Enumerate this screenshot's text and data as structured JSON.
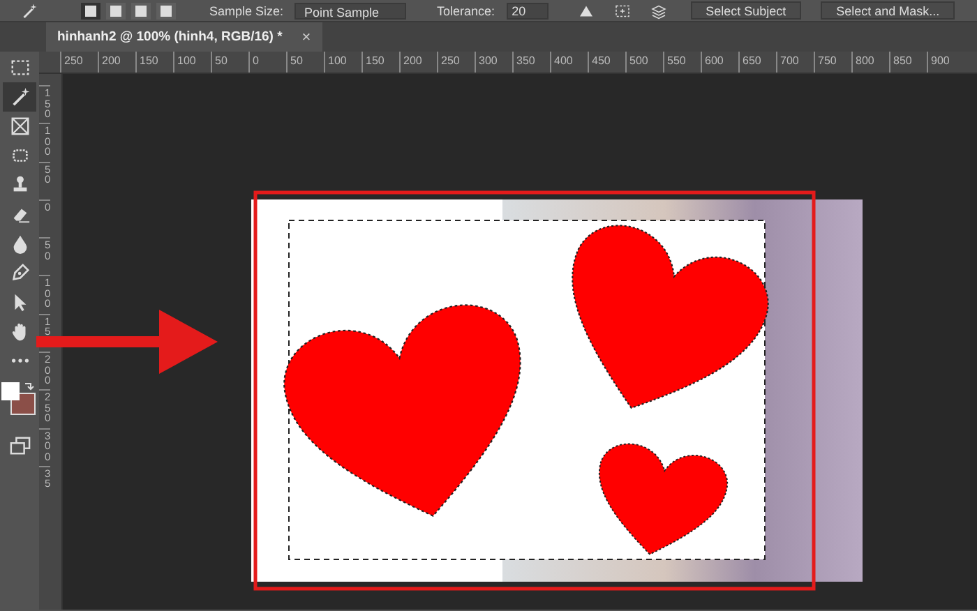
{
  "options_bar": {
    "selection_modes": [
      {
        "selected": true
      },
      {
        "selected": false
      },
      {
        "selected": false
      },
      {
        "selected": false
      }
    ],
    "sample_size_label": "Sample Size:",
    "sample_size_value": "Point Sample",
    "tolerance_label": "Tolerance:",
    "tolerance_value": "20",
    "buttons": [
      "Select Subject",
      "Select and Mask..."
    ]
  },
  "document_tab": {
    "title": "hinhanh2 @ 100% (hinh4, RGB/16) *",
    "close": "×"
  },
  "horizontal_ruler": [
    "250",
    "200",
    "150",
    "100",
    "50",
    "0",
    "50",
    "100",
    "150",
    "200",
    "250",
    "300",
    "350",
    "400",
    "450",
    "500",
    "550",
    "600",
    "650",
    "700",
    "750",
    "800",
    "850",
    "900"
  ],
  "vertical_ruler": [
    "150",
    "100",
    "50",
    "0",
    "50",
    "100",
    "15",
    "200",
    "250",
    "300",
    "35"
  ],
  "tools": [
    {
      "kind": "marquee",
      "selected": false
    },
    {
      "kind": "wand",
      "selected": true
    },
    {
      "kind": "frame",
      "selected": false
    },
    {
      "kind": "patch",
      "selected": false
    },
    {
      "kind": "stamp",
      "selected": false
    },
    {
      "kind": "eraser",
      "selected": false
    },
    {
      "kind": "drop",
      "selected": false
    },
    {
      "kind": "pen",
      "selected": false
    },
    {
      "kind": "pointer",
      "selected": false
    },
    {
      "kind": "hand",
      "selected": false
    },
    {
      "kind": "more",
      "selected": false
    }
  ]
}
